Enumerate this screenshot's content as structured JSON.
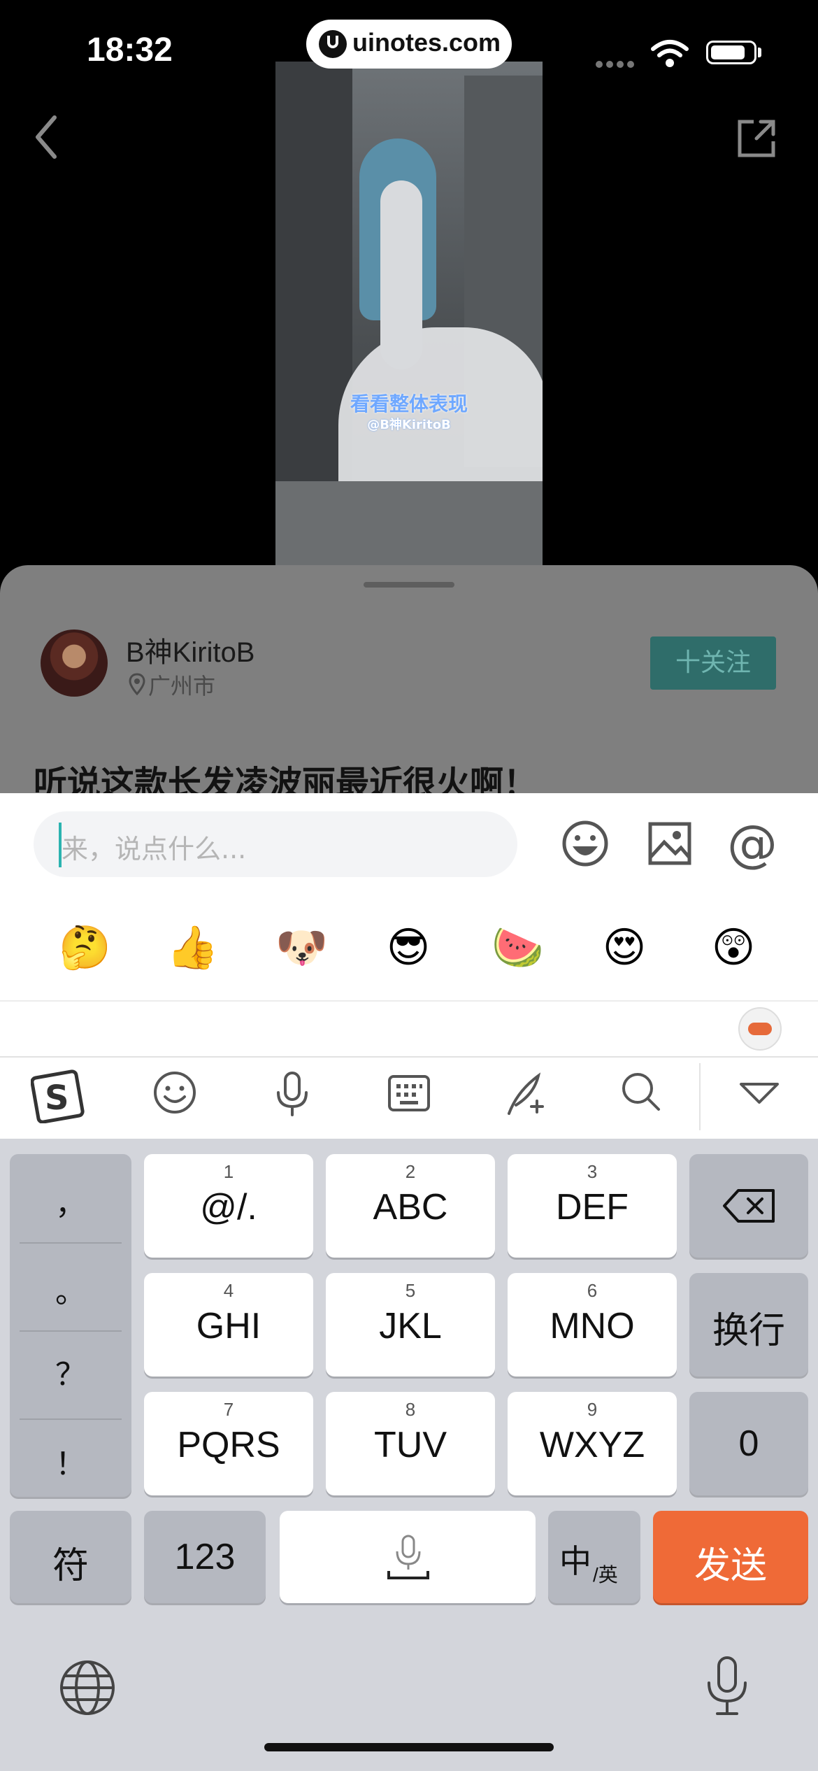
{
  "status_bar": {
    "time": "18:32",
    "url": "uinotes.com"
  },
  "video": {
    "caption": "看看整体表现",
    "watermark": "@B神KiritoB"
  },
  "post": {
    "author_name": "B神KiritoB",
    "location": "广州市",
    "follow_label": "十关注",
    "title": "听说这款长发凌波丽最近很火啊！"
  },
  "comment": {
    "placeholder": "来，说点什么...",
    "quick_emojis": [
      "🤔",
      "👍",
      "🐶",
      "😎",
      "🍉",
      "😍",
      "😲"
    ]
  },
  "ime_toolbar": {
    "icons": [
      "sogou-logo-icon",
      "emoji-icon",
      "microphone-icon",
      "keyboard-icon",
      "quill-icon",
      "search-icon",
      "chevron-down-icon"
    ]
  },
  "keyboard": {
    "punctuation": [
      "，",
      "。",
      "？",
      "！"
    ],
    "keys": [
      {
        "num": "1",
        "label": "@/."
      },
      {
        "num": "2",
        "label": "ABC"
      },
      {
        "num": "3",
        "label": "DEF"
      },
      {
        "num": "4",
        "label": "GHI"
      },
      {
        "num": "5",
        "label": "JKL"
      },
      {
        "num": "6",
        "label": "MNO"
      },
      {
        "num": "7",
        "label": "PQRS"
      },
      {
        "num": "8",
        "label": "TUV"
      },
      {
        "num": "9",
        "label": "WXYZ"
      }
    ],
    "newline_label": "换行",
    "zero_label": "0",
    "symbol_label": "符",
    "numbers_label": "123",
    "lang_main": "中",
    "lang_sub": "/英",
    "send_label": "发送",
    "colors": {
      "send": "#ef6a37",
      "accent": "#2bb3b0"
    }
  }
}
